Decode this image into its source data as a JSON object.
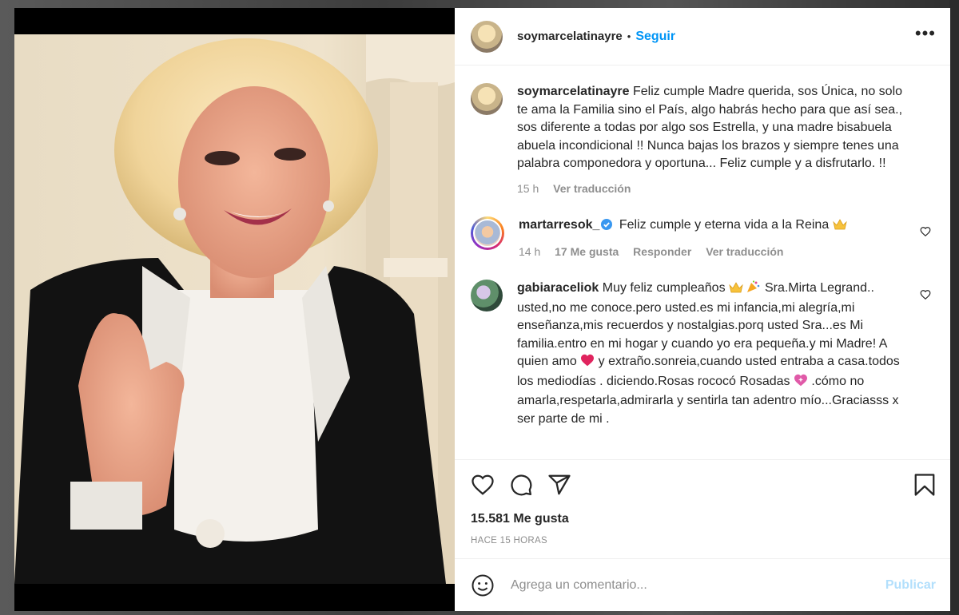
{
  "post": {
    "username": "soymarcelatinayre",
    "dot": "•",
    "follow_label": "Seguir",
    "more_label": "•••"
  },
  "caption": {
    "username": "soymarcelatinayre",
    "text": "Feliz cumple Madre querida, sos Única, no solo te ama la Familia sino el País, algo habrás hecho para que así sea., sos diferente a todas por algo sos Estrella, y una madre bisabuela abuela incondicional !! Nunca bajas los brazos y siempre tenes una palabra componedora y oportuna... Feliz cumple y a disfrutarlo. !!",
    "time": "15 h",
    "translate": "Ver traducción"
  },
  "comments": [
    {
      "username": "martarresok_",
      "verified": true,
      "text": "Feliz cumple y eterna vida a la Reina",
      "time": "14 h",
      "likes": "17 Me gusta",
      "reply": "Responder",
      "translate": "Ver traducción"
    },
    {
      "username": "gabiaraceliok",
      "text_a": "Muy feliz cumpleaños",
      "text_b": "Sra.Mirta Legrand.. usted,no me conoce.pero usted.es mi infancia,mi alegría,mi enseñanza,mis recuerdos y nostalgias.porq usted Sra...es Mi familia.entro en mi hogar y cuando yo era pequeña.y mi Madre! A quien amo",
      "text_c": "y extraño.sonreia,cuando usted entraba a casa.todos los mediodías . diciendo.Rosas rococó Rosadas",
      "text_d": ".cómo no amarla,respetarla,admirarla y sentirla tan adentro mío...Graciasss x ser parte de mi ."
    }
  ],
  "stats": {
    "likes": "15.581 Me gusta",
    "ago": "HACE 15 HORAS"
  },
  "composer": {
    "placeholder": "Agrega un comentario...",
    "publish": "Publicar"
  },
  "icons": [
    "heart-icon",
    "comment-icon",
    "share-icon",
    "bookmark-icon",
    "emoji-icon",
    "verified-icon",
    "crown-emoji",
    "party-emoji",
    "red-heart-emoji",
    "sparkling-heart-emoji"
  ],
  "colors": {
    "accent": "#0095f6",
    "publish_disabled": "#b2dffc",
    "muted": "#8e8e8e",
    "verified": "#3897f0"
  }
}
